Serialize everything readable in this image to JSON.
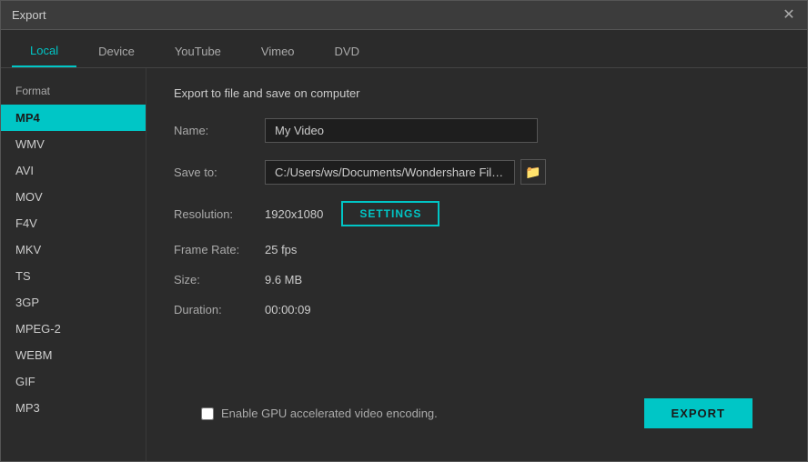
{
  "window": {
    "title": "Export",
    "close_label": "✕"
  },
  "tabs": [
    {
      "id": "local",
      "label": "Local",
      "active": true
    },
    {
      "id": "device",
      "label": "Device",
      "active": false
    },
    {
      "id": "youtube",
      "label": "YouTube",
      "active": false
    },
    {
      "id": "vimeo",
      "label": "Vimeo",
      "active": false
    },
    {
      "id": "dvd",
      "label": "DVD",
      "active": false
    }
  ],
  "sidebar": {
    "label": "Format",
    "formats": [
      {
        "id": "mp4",
        "label": "MP4",
        "active": true
      },
      {
        "id": "wmv",
        "label": "WMV",
        "active": false
      },
      {
        "id": "avi",
        "label": "AVI",
        "active": false
      },
      {
        "id": "mov",
        "label": "MOV",
        "active": false
      },
      {
        "id": "f4v",
        "label": "F4V",
        "active": false
      },
      {
        "id": "mkv",
        "label": "MKV",
        "active": false
      },
      {
        "id": "ts",
        "label": "TS",
        "active": false
      },
      {
        "id": "3gp",
        "label": "3GP",
        "active": false
      },
      {
        "id": "mpeg2",
        "label": "MPEG-2",
        "active": false
      },
      {
        "id": "webm",
        "label": "WEBM",
        "active": false
      },
      {
        "id": "gif",
        "label": "GIF",
        "active": false
      },
      {
        "id": "mp3",
        "label": "MP3",
        "active": false
      }
    ]
  },
  "main": {
    "panel_title": "Export to file and save on computer",
    "fields": {
      "name_label": "Name:",
      "name_value": "My Video",
      "save_to_label": "Save to:",
      "save_to_value": "C:/Users/ws/Documents/Wondershare Filmo",
      "resolution_label": "Resolution:",
      "resolution_value": "1920x1080",
      "settings_label": "SETTINGS",
      "frame_rate_label": "Frame Rate:",
      "frame_rate_value": "25 fps",
      "size_label": "Size:",
      "size_value": "9.6 MB",
      "duration_label": "Duration:",
      "duration_value": "00:00:09"
    }
  },
  "bottom": {
    "gpu_label": "Enable GPU accelerated video encoding.",
    "export_label": "EXPORT"
  },
  "icons": {
    "folder": "📁",
    "close": "✕"
  }
}
